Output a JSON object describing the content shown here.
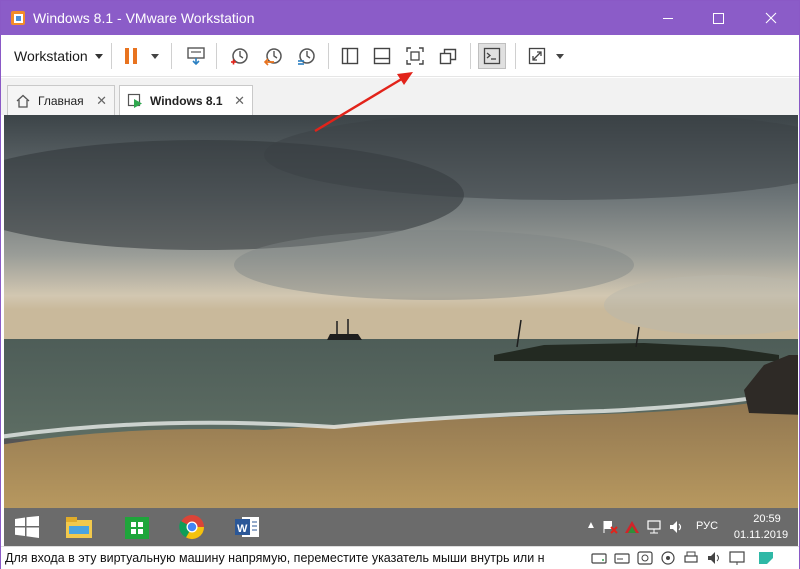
{
  "window": {
    "title": "Windows 8.1 - VMware Workstation",
    "minimize_glyph": "—",
    "maximize_glyph": "☐",
    "close_glyph": "✕"
  },
  "toolbar": {
    "workstation_label": "Workstation",
    "buttons": [
      {
        "name": "pause-icon"
      },
      {
        "name": "send-ctrl-alt-del-icon"
      },
      {
        "name": "snapshot-take-icon"
      },
      {
        "name": "snapshot-revert-icon"
      },
      {
        "name": "snapshot-manager-icon"
      },
      {
        "name": "show-library-icon"
      },
      {
        "name": "show-thumbnail-bar-icon"
      },
      {
        "name": "full-screen-icon"
      },
      {
        "name": "unity-icon"
      },
      {
        "name": "console-view-icon"
      },
      {
        "name": "stretch-guest-icon"
      }
    ]
  },
  "tabs": [
    {
      "label": "Главная",
      "icon": "home-icon",
      "close": "✕"
    },
    {
      "label": "Windows 8.1",
      "icon": "vm-running-icon",
      "close": "✕",
      "active": true
    }
  ],
  "guest_taskbar": {
    "apps": [
      "file-explorer-icon",
      "windows-store-icon",
      "chrome-icon",
      "word-icon"
    ],
    "chevron": "▲",
    "language": "РУС",
    "time": "20:59",
    "date": "01.11.2019"
  },
  "statusbar": {
    "message": "Для входа в эту виртуальную машину напрямую, переместите указатель мыши внутрь или н",
    "device_icons": [
      "hard-disk-icon",
      "cd-dvd-icon",
      "network-icon",
      "usb-icon",
      "printer-icon",
      "sound-icon",
      "display-icon",
      "message-log-icon"
    ]
  },
  "colors": {
    "titlebar": "#8b5cc8",
    "pause": "#e8731f",
    "annotation": "#e2231a"
  }
}
